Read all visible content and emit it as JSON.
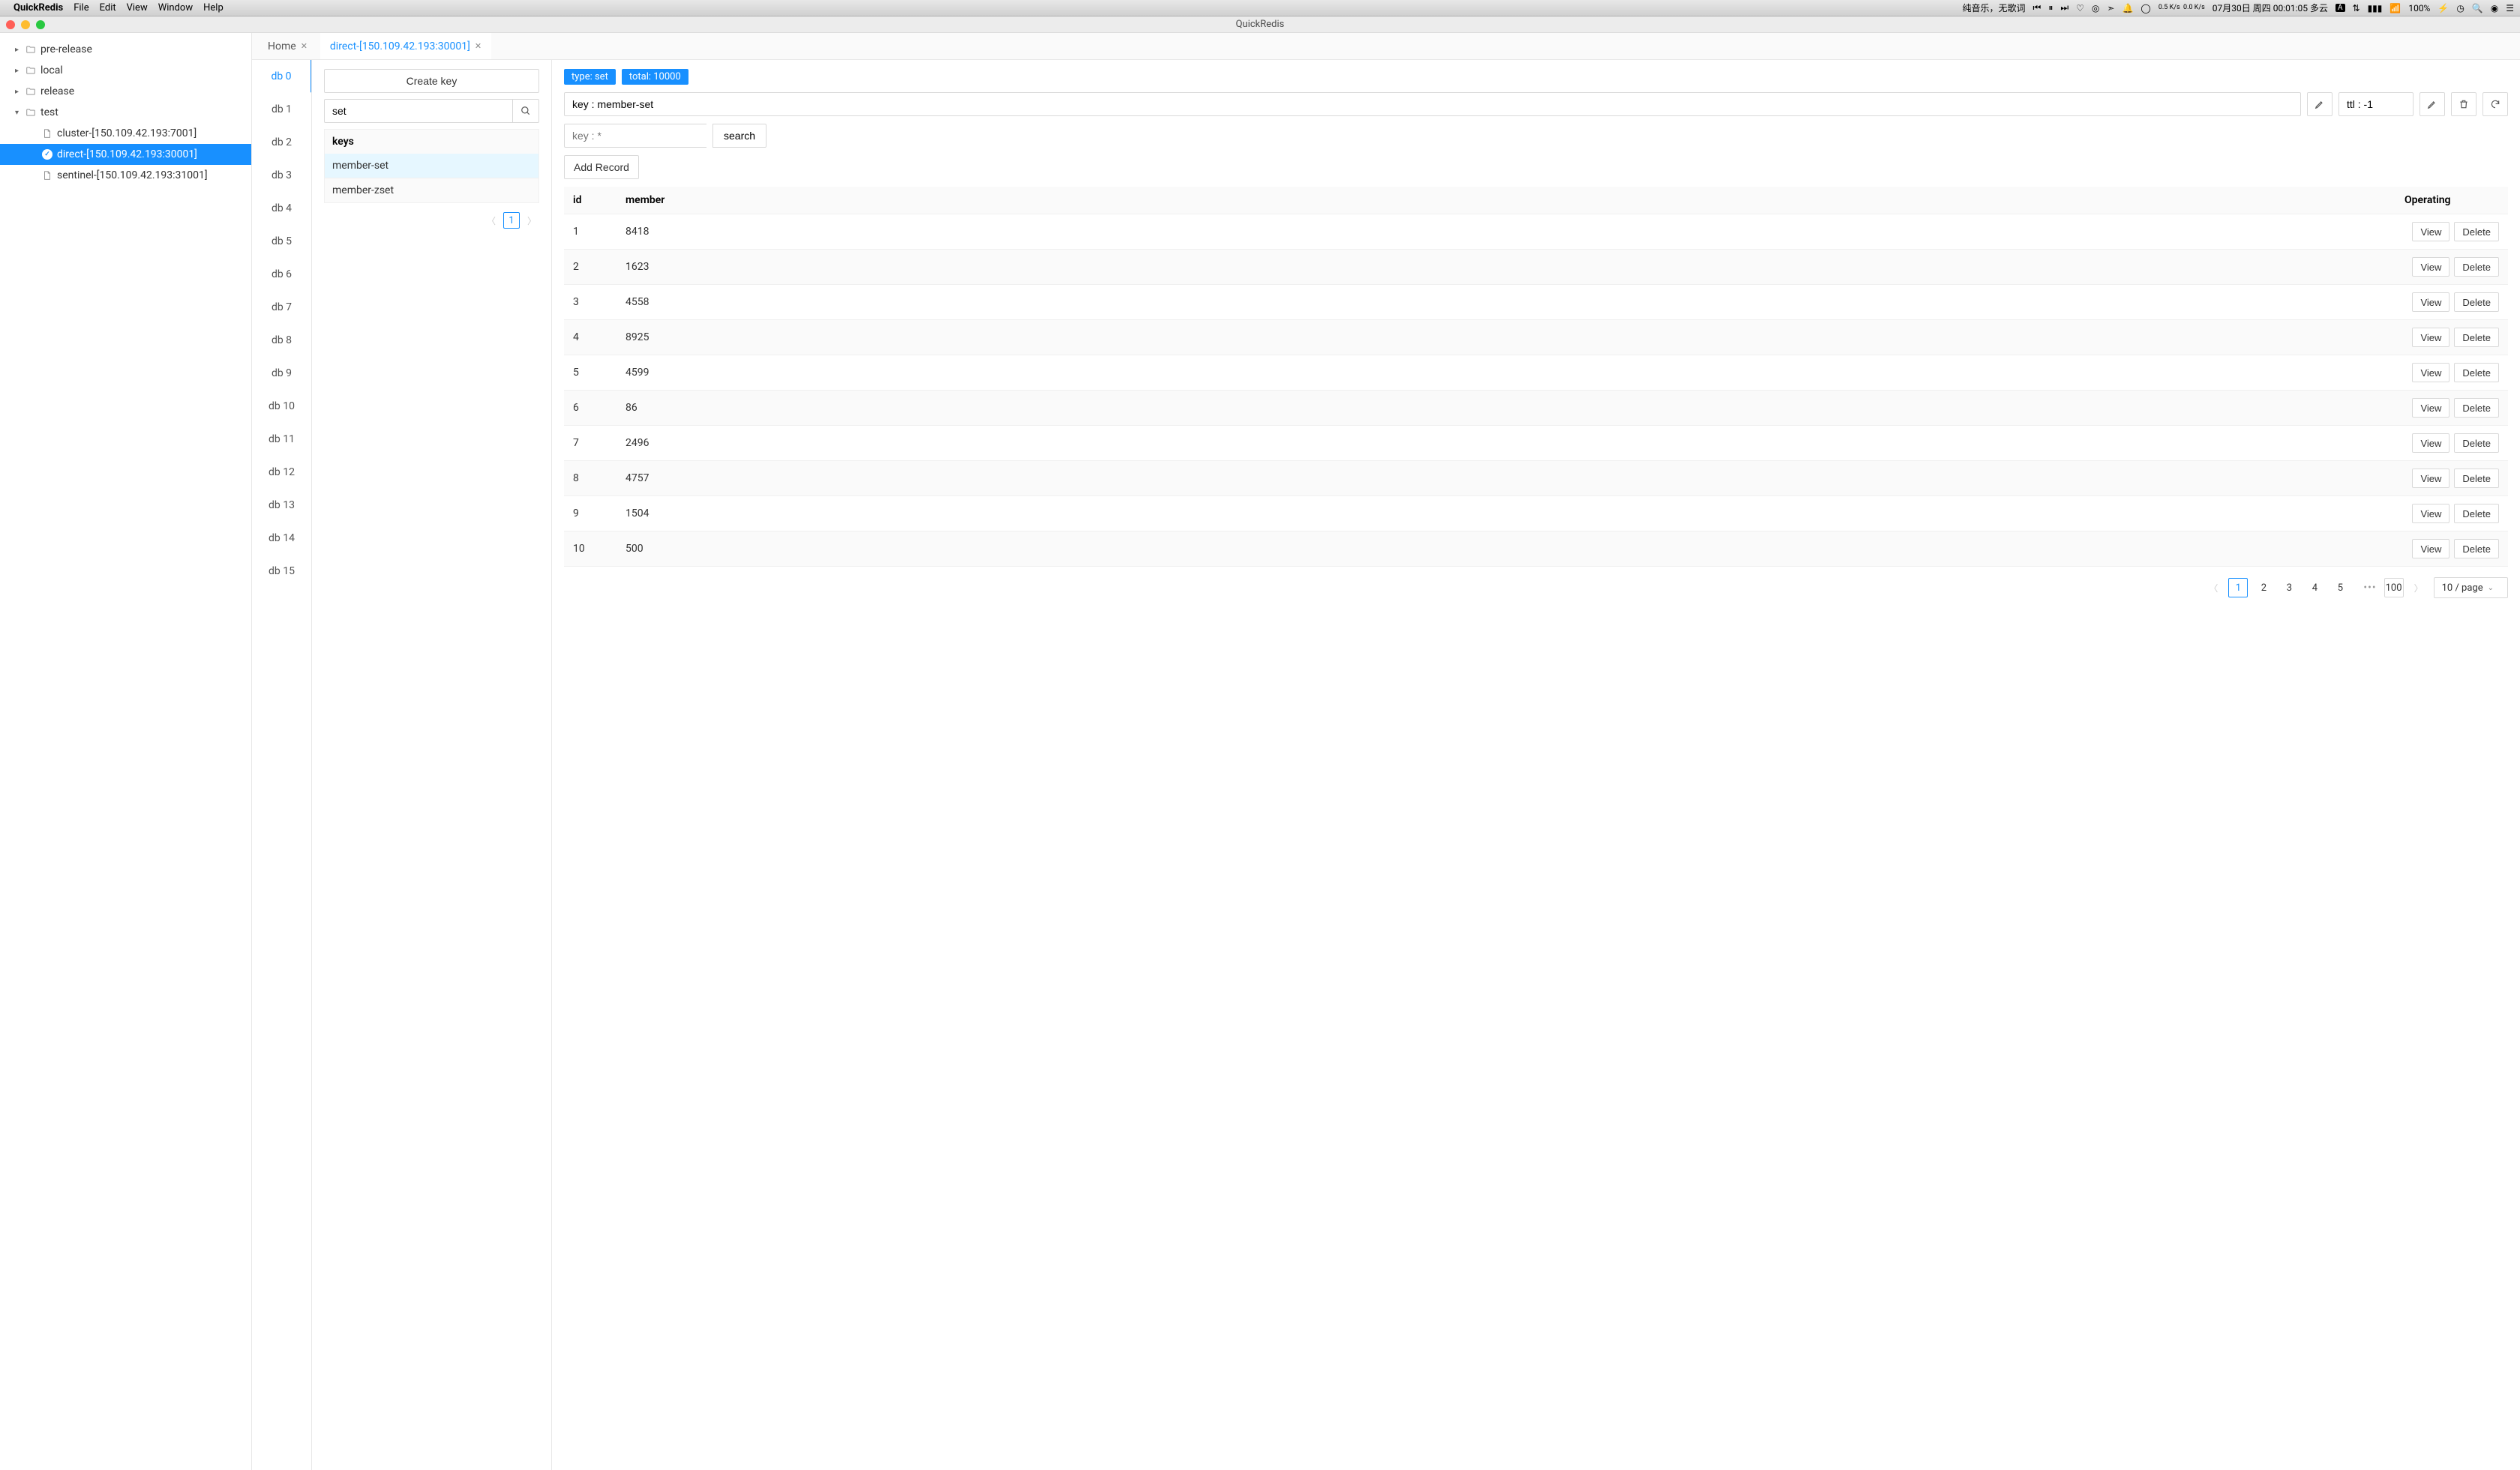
{
  "menubar": {
    "app_name": "QuickRedis",
    "items": [
      "File",
      "Edit",
      "View",
      "Window",
      "Help"
    ],
    "status_music": "纯音乐，无歌词",
    "status_net": "0.5 K/s  0.0 K/s",
    "status_date": "07月30日 周四 00:01:05 多云",
    "status_battery": "100%"
  },
  "window": {
    "title": "QuickRedis"
  },
  "sidebar": {
    "folders": [
      {
        "label": "pre-release",
        "expanded": false
      },
      {
        "label": "local",
        "expanded": false
      },
      {
        "label": "release",
        "expanded": false
      },
      {
        "label": "test",
        "expanded": true,
        "children": [
          {
            "label": "cluster-[150.109.42.193:7001]",
            "selected": false,
            "connected": false
          },
          {
            "label": "direct-[150.109.42.193:30001]",
            "selected": true,
            "connected": true
          },
          {
            "label": "sentinel-[150.109.42.193:31001]",
            "selected": false,
            "connected": false
          }
        ]
      }
    ]
  },
  "tabs": [
    {
      "label": "Home",
      "active": false
    },
    {
      "label": "direct-[150.109.42.193:30001]",
      "active": true
    }
  ],
  "dbs": {
    "items": [
      "db 0",
      "db 1",
      "db 2",
      "db 3",
      "db 4",
      "db 5",
      "db 6",
      "db 7",
      "db 8",
      "db 9",
      "db 10",
      "db 11",
      "db 12",
      "db 13",
      "db 14",
      "db 15"
    ],
    "active_index": 0
  },
  "keys_panel": {
    "create_btn": "Create key",
    "search_value": "set",
    "header": "keys",
    "keys": [
      {
        "name": "member-set",
        "selected": true
      },
      {
        "name": "member-zset",
        "selected": false
      }
    ],
    "page_current": "1"
  },
  "detail": {
    "type_tag": "type: set",
    "total_tag": "total: 10000",
    "key_value": "key : member-set",
    "ttl_value": "ttl : -1",
    "search_placeholder": "key : *",
    "search_btn": "search",
    "add_record_btn": "Add Record",
    "columns": {
      "id": "id",
      "member": "member",
      "op": "Operating"
    },
    "rows": [
      {
        "id": "1",
        "member": "8418"
      },
      {
        "id": "2",
        "member": "1623"
      },
      {
        "id": "3",
        "member": "4558"
      },
      {
        "id": "4",
        "member": "8925"
      },
      {
        "id": "5",
        "member": "4599"
      },
      {
        "id": "6",
        "member": "86"
      },
      {
        "id": "7",
        "member": "2496"
      },
      {
        "id": "8",
        "member": "4757"
      },
      {
        "id": "9",
        "member": "1504"
      },
      {
        "id": "10",
        "member": "500"
      }
    ],
    "op_view": "View",
    "op_delete": "Delete",
    "pagination": {
      "pages": [
        "1",
        "2",
        "3",
        "4",
        "5"
      ],
      "last": "100",
      "page_size": "10 / page"
    }
  }
}
